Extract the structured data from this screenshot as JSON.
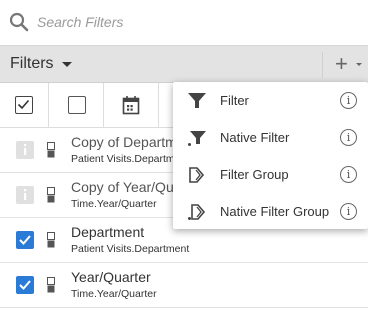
{
  "search": {
    "placeholder": "Search Filters",
    "icon": "search-icon"
  },
  "header": {
    "title": "Filters",
    "add_label": "+"
  },
  "toolbar": {
    "icons": [
      "select-all-checkbox-icon",
      "checkbox-icon",
      "calendar-icon"
    ]
  },
  "rows": [
    {
      "name": "Copy of Department",
      "path": "Patient Visits.Department",
      "state": "disabled"
    },
    {
      "name": "Copy of Year/Quarter",
      "path": "Time.Year/Quarter",
      "state": "disabled"
    },
    {
      "name": "Department",
      "path": "Patient Visits.Department",
      "state": "checked"
    },
    {
      "name": "Year/Quarter",
      "path": "Time.Year/Quarter",
      "state": "checked"
    }
  ],
  "menu": {
    "items": [
      {
        "label": "Filter",
        "icon": "funnel-icon",
        "info": "i"
      },
      {
        "label": "Native Filter",
        "icon": "native-funnel-icon",
        "info": "i"
      },
      {
        "label": "Filter Group",
        "icon": "filter-group-icon",
        "info": "i"
      },
      {
        "label": "Native Filter Group",
        "icon": "native-filter-group-icon",
        "info": "i"
      }
    ]
  },
  "colors": {
    "accent": "#2a7bd6",
    "header_bg": "#e3e3e3"
  }
}
